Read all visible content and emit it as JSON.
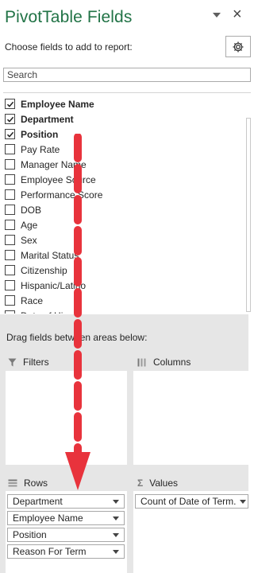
{
  "header": {
    "title": "PivotTable Fields",
    "close_glyph": "×",
    "choose_label": "Choose fields to add to report:",
    "settings_icon": "gear-icon",
    "dropdown_icon": "chevron-down-icon"
  },
  "search": {
    "placeholder": "Search"
  },
  "fields": [
    {
      "label": "Employee Name",
      "checked": true
    },
    {
      "label": "Department",
      "checked": true
    },
    {
      "label": "Position",
      "checked": true
    },
    {
      "label": "Pay Rate",
      "checked": false
    },
    {
      "label": "Manager Name",
      "checked": false
    },
    {
      "label": "Employee Source",
      "checked": false
    },
    {
      "label": "Performance Score",
      "checked": false
    },
    {
      "label": "DOB",
      "checked": false
    },
    {
      "label": "Age",
      "checked": false
    },
    {
      "label": "Sex",
      "checked": false
    },
    {
      "label": "Marital Status",
      "checked": false
    },
    {
      "label": "Citizenship",
      "checked": false
    },
    {
      "label": "Hispanic/Latino",
      "checked": false
    },
    {
      "label": "Race",
      "checked": false
    },
    {
      "label": "Date of Hire",
      "checked": false
    }
  ],
  "areas": {
    "drag_label": "Drag fields between areas below:",
    "filters": {
      "label": "Filters",
      "icon": "filter-icon"
    },
    "columns": {
      "label": "Columns",
      "icon": "columns-icon"
    },
    "rows": {
      "label": "Rows",
      "icon": "rows-icon",
      "chips": [
        "Department",
        "Employee Name",
        "Position",
        "Reason For Term"
      ]
    },
    "values": {
      "label": "Values",
      "icon": "sigma-icon",
      "chips": [
        "Count of Date of Term..."
      ]
    }
  },
  "annotation": {
    "arrow_color": "#e8333c"
  }
}
